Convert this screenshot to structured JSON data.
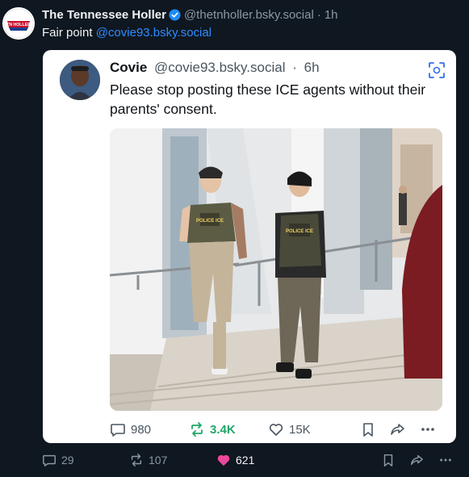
{
  "post": {
    "author_name": "The Tennessee Holler",
    "handle": "@thetnholler.bsky.social",
    "separator": "·",
    "time": "1h",
    "avatar_text": "TN HOLLER",
    "text_prefix": "Fair point",
    "text_mention": "@covie93.bsky.social",
    "actions": {
      "replies": "29",
      "reposts": "107",
      "likes": "621"
    }
  },
  "quote": {
    "author_name": "Covie",
    "handle": "@covie93.bsky.social",
    "separator": "·",
    "time": "6h",
    "text": "Please stop posting these ICE agents without their parents' consent.",
    "image_badges": [
      "POLICE ICE",
      "POLICE ICE"
    ],
    "actions": {
      "replies": "980",
      "reposts": "3.4K",
      "likes": "15K"
    }
  },
  "colors": {
    "background": "#0f1720",
    "accent_link": "#2f8cff",
    "repost_active": "#20a66a",
    "like_active": "#ec4899",
    "verified": "#1d8cf8"
  },
  "icons": [
    "verified-badge-icon",
    "scan-icon",
    "reply-icon",
    "repost-icon",
    "like-icon",
    "bookmark-icon",
    "share-icon",
    "more-icon"
  ]
}
